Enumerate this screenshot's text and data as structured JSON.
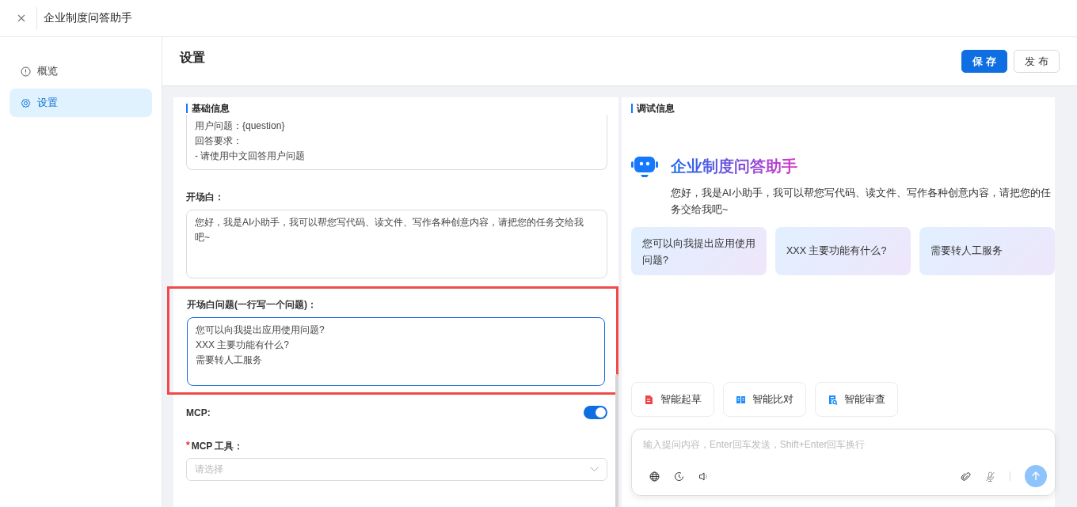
{
  "window": {
    "title": "企业制度问答助手"
  },
  "sidebar": {
    "items": [
      {
        "label": "概览",
        "selected": false
      },
      {
        "label": "设置",
        "selected": true
      }
    ]
  },
  "header": {
    "title": "设置",
    "buttons": [
      {
        "label": "保 存",
        "kind": "primary"
      },
      {
        "label": "发 布",
        "kind": "default"
      }
    ]
  },
  "basic_info": {
    "title": "基础信息",
    "prompt": {
      "lines": [
        "用户问题：{question}",
        "回答要求：",
        "- 请使用中文回答用户问题"
      ]
    },
    "opening": {
      "label": "开场白：",
      "value": "您好，我是AI小助手，我可以帮您写代码、读文件、写作各种创意内容，请把您的任务交给我吧~"
    },
    "opening_questions": {
      "label": "开场白问题(一行写一个问题)：",
      "lines": [
        "您可以向我提出应用使用问题?",
        "XXX 主要功能有什么?",
        "需要转人工服务"
      ],
      "highlighted": true,
      "focused": true
    },
    "mcp": {
      "label": "MCP:",
      "on": true
    },
    "mcp_tools": {
      "label": "MCP 工具：",
      "required_mark": "*",
      "placeholder": "请选择"
    }
  },
  "debug": {
    "title": "调试信息",
    "bot_name": "企业制度问答助手",
    "greeting": "您好，我是AI小助手，我可以帮您写代码、读文件、写作各种创意内容，请把您的任务交给我吧~",
    "suggestions": [
      "您可以向我提出应用使用问题?",
      "XXX 主要功能有什么?",
      "需要转人工服务"
    ],
    "skills": [
      {
        "label": "智能起草",
        "color": "#f0474b"
      },
      {
        "label": "智能比对",
        "color": "#1d8cf8"
      },
      {
        "label": "智能审查",
        "color": "#1d8cf8"
      }
    ],
    "input": {
      "placeholder": "输入提问内容，Enter回车发送，Shift+Enter回车换行"
    }
  }
}
